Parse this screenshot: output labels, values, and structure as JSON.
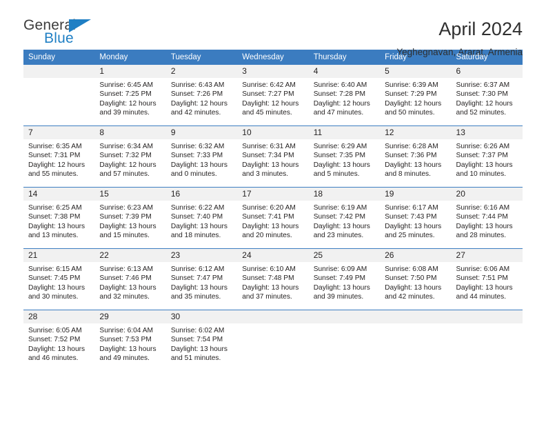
{
  "logo": {
    "word_one": "General",
    "word_two": "Blue",
    "triangle_color": "#1f7fc4"
  },
  "header": {
    "title": "April 2024",
    "location": "Yeghegnavan, Ararat, Armenia"
  },
  "theme": {
    "header_blue": "#3b7cc0",
    "daynum_gray": "#f1f1f1",
    "text": "#221f1f"
  },
  "weekday_headers": [
    "Sunday",
    "Monday",
    "Tuesday",
    "Wednesday",
    "Thursday",
    "Friday",
    "Saturday"
  ],
  "weeks": [
    [
      {
        "day": "",
        "sunrise": "",
        "sunset": "",
        "daylight": "",
        "empty": true
      },
      {
        "day": "1",
        "sunrise": "Sunrise: 6:45 AM",
        "sunset": "Sunset: 7:25 PM",
        "daylight": "Daylight: 12 hours and 39 minutes."
      },
      {
        "day": "2",
        "sunrise": "Sunrise: 6:43 AM",
        "sunset": "Sunset: 7:26 PM",
        "daylight": "Daylight: 12 hours and 42 minutes."
      },
      {
        "day": "3",
        "sunrise": "Sunrise: 6:42 AM",
        "sunset": "Sunset: 7:27 PM",
        "daylight": "Daylight: 12 hours and 45 minutes."
      },
      {
        "day": "4",
        "sunrise": "Sunrise: 6:40 AM",
        "sunset": "Sunset: 7:28 PM",
        "daylight": "Daylight: 12 hours and 47 minutes."
      },
      {
        "day": "5",
        "sunrise": "Sunrise: 6:39 AM",
        "sunset": "Sunset: 7:29 PM",
        "daylight": "Daylight: 12 hours and 50 minutes."
      },
      {
        "day": "6",
        "sunrise": "Sunrise: 6:37 AM",
        "sunset": "Sunset: 7:30 PM",
        "daylight": "Daylight: 12 hours and 52 minutes."
      }
    ],
    [
      {
        "day": "7",
        "sunrise": "Sunrise: 6:35 AM",
        "sunset": "Sunset: 7:31 PM",
        "daylight": "Daylight: 12 hours and 55 minutes."
      },
      {
        "day": "8",
        "sunrise": "Sunrise: 6:34 AM",
        "sunset": "Sunset: 7:32 PM",
        "daylight": "Daylight: 12 hours and 57 minutes."
      },
      {
        "day": "9",
        "sunrise": "Sunrise: 6:32 AM",
        "sunset": "Sunset: 7:33 PM",
        "daylight": "Daylight: 13 hours and 0 minutes."
      },
      {
        "day": "10",
        "sunrise": "Sunrise: 6:31 AM",
        "sunset": "Sunset: 7:34 PM",
        "daylight": "Daylight: 13 hours and 3 minutes."
      },
      {
        "day": "11",
        "sunrise": "Sunrise: 6:29 AM",
        "sunset": "Sunset: 7:35 PM",
        "daylight": "Daylight: 13 hours and 5 minutes."
      },
      {
        "day": "12",
        "sunrise": "Sunrise: 6:28 AM",
        "sunset": "Sunset: 7:36 PM",
        "daylight": "Daylight: 13 hours and 8 minutes."
      },
      {
        "day": "13",
        "sunrise": "Sunrise: 6:26 AM",
        "sunset": "Sunset: 7:37 PM",
        "daylight": "Daylight: 13 hours and 10 minutes."
      }
    ],
    [
      {
        "day": "14",
        "sunrise": "Sunrise: 6:25 AM",
        "sunset": "Sunset: 7:38 PM",
        "daylight": "Daylight: 13 hours and 13 minutes."
      },
      {
        "day": "15",
        "sunrise": "Sunrise: 6:23 AM",
        "sunset": "Sunset: 7:39 PM",
        "daylight": "Daylight: 13 hours and 15 minutes."
      },
      {
        "day": "16",
        "sunrise": "Sunrise: 6:22 AM",
        "sunset": "Sunset: 7:40 PM",
        "daylight": "Daylight: 13 hours and 18 minutes."
      },
      {
        "day": "17",
        "sunrise": "Sunrise: 6:20 AM",
        "sunset": "Sunset: 7:41 PM",
        "daylight": "Daylight: 13 hours and 20 minutes."
      },
      {
        "day": "18",
        "sunrise": "Sunrise: 6:19 AM",
        "sunset": "Sunset: 7:42 PM",
        "daylight": "Daylight: 13 hours and 23 minutes."
      },
      {
        "day": "19",
        "sunrise": "Sunrise: 6:17 AM",
        "sunset": "Sunset: 7:43 PM",
        "daylight": "Daylight: 13 hours and 25 minutes."
      },
      {
        "day": "20",
        "sunrise": "Sunrise: 6:16 AM",
        "sunset": "Sunset: 7:44 PM",
        "daylight": "Daylight: 13 hours and 28 minutes."
      }
    ],
    [
      {
        "day": "21",
        "sunrise": "Sunrise: 6:15 AM",
        "sunset": "Sunset: 7:45 PM",
        "daylight": "Daylight: 13 hours and 30 minutes."
      },
      {
        "day": "22",
        "sunrise": "Sunrise: 6:13 AM",
        "sunset": "Sunset: 7:46 PM",
        "daylight": "Daylight: 13 hours and 32 minutes."
      },
      {
        "day": "23",
        "sunrise": "Sunrise: 6:12 AM",
        "sunset": "Sunset: 7:47 PM",
        "daylight": "Daylight: 13 hours and 35 minutes."
      },
      {
        "day": "24",
        "sunrise": "Sunrise: 6:10 AM",
        "sunset": "Sunset: 7:48 PM",
        "daylight": "Daylight: 13 hours and 37 minutes."
      },
      {
        "day": "25",
        "sunrise": "Sunrise: 6:09 AM",
        "sunset": "Sunset: 7:49 PM",
        "daylight": "Daylight: 13 hours and 39 minutes."
      },
      {
        "day": "26",
        "sunrise": "Sunrise: 6:08 AM",
        "sunset": "Sunset: 7:50 PM",
        "daylight": "Daylight: 13 hours and 42 minutes."
      },
      {
        "day": "27",
        "sunrise": "Sunrise: 6:06 AM",
        "sunset": "Sunset: 7:51 PM",
        "daylight": "Daylight: 13 hours and 44 minutes."
      }
    ],
    [
      {
        "day": "28",
        "sunrise": "Sunrise: 6:05 AM",
        "sunset": "Sunset: 7:52 PM",
        "daylight": "Daylight: 13 hours and 46 minutes."
      },
      {
        "day": "29",
        "sunrise": "Sunrise: 6:04 AM",
        "sunset": "Sunset: 7:53 PM",
        "daylight": "Daylight: 13 hours and 49 minutes."
      },
      {
        "day": "30",
        "sunrise": "Sunrise: 6:02 AM",
        "sunset": "Sunset: 7:54 PM",
        "daylight": "Daylight: 13 hours and 51 minutes."
      },
      {
        "day": "",
        "sunrise": "",
        "sunset": "",
        "daylight": "",
        "empty": true
      },
      {
        "day": "",
        "sunrise": "",
        "sunset": "",
        "daylight": "",
        "empty": true
      },
      {
        "day": "",
        "sunrise": "",
        "sunset": "",
        "daylight": "",
        "empty": true
      },
      {
        "day": "",
        "sunrise": "",
        "sunset": "",
        "daylight": "",
        "empty": true
      }
    ]
  ]
}
